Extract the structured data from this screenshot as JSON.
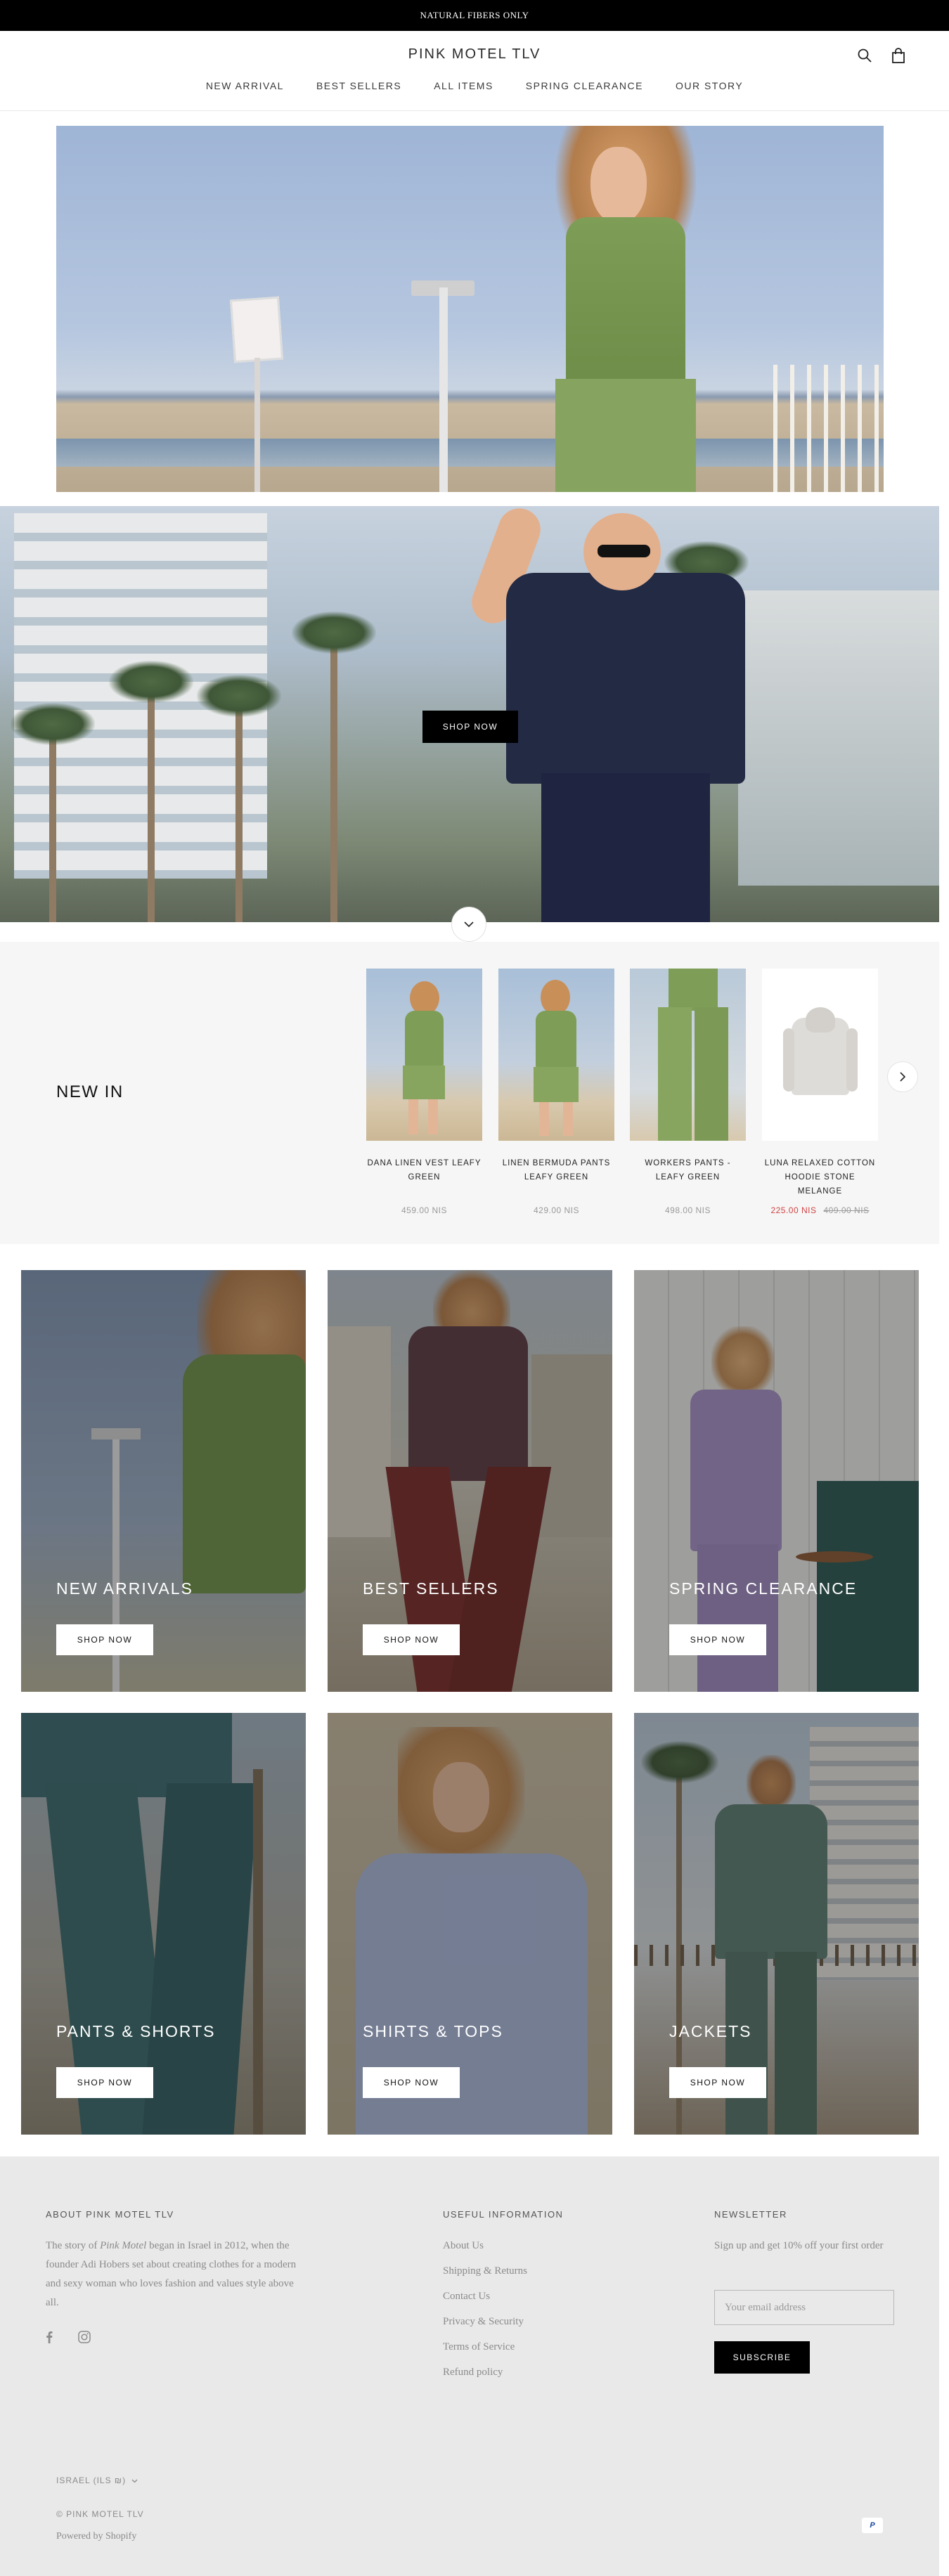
{
  "announcement": "NATURAL FIBERS ONLY",
  "header": {
    "logo": "PINK MOTEL TLV",
    "nav": [
      "NEW ARRIVAL",
      "BEST SELLERS",
      "ALL ITEMS",
      "SPRING CLEARANCE",
      "OUR STORY"
    ],
    "icons": [
      "search-icon",
      "bag-icon"
    ]
  },
  "hero": {
    "shop_now": "SHOP NOW"
  },
  "new_in": {
    "title": "NEW IN",
    "products": [
      {
        "name": "DANA LINEN VEST LEAFY GREEN",
        "price": "459.00 NIS"
      },
      {
        "name": "LINEN BERMUDA PANTS LEAFY GREEN",
        "price": "429.00 NIS"
      },
      {
        "name": "WORKERS PANTS - LEAFY GREEN",
        "price": "498.00 NIS"
      },
      {
        "name": "LUNA RELAXED COTTON HOODIE STONE MELANGE",
        "sale_price": "225.00 NIS",
        "compare_price": "409.00 NIS"
      }
    ]
  },
  "categories": [
    {
      "label": "NEW ARRIVALS",
      "button": "SHOP NOW"
    },
    {
      "label": "BEST SELLERS",
      "button": "SHOP NOW"
    },
    {
      "label": "SPRING CLEARANCE",
      "button": "SHOP NOW"
    },
    {
      "label": "PANTS & SHORTS",
      "button": "SHOP NOW"
    },
    {
      "label": "SHIRTS & TOPS",
      "button": "SHOP NOW"
    },
    {
      "label": "JACKETS",
      "button": "SHOP NOW"
    }
  ],
  "footer": {
    "about_title": "ABOUT PINK MOTEL TLV",
    "about_text_1": "The story of ",
    "about_brand": "Pink Motel",
    "about_text_2": " began in Israel in 2012, when the founder Adi Hobers set about creating clothes for a modern and sexy woman who loves fashion and values style above all.",
    "social": [
      "facebook-icon",
      "instagram-icon"
    ],
    "info_title": "USEFUL INFORMATION",
    "info_links": [
      "About Us",
      "Shipping & Returns",
      "Contact Us",
      "Privacy & Security",
      "Terms of Service",
      "Refund policy"
    ],
    "newsletter_title": "NEWSLETTER",
    "newsletter_text": "Sign up and get 10% off your first order",
    "email_placeholder": "Your email address",
    "subscribe": "SUBSCRIBE",
    "currency": "ISRAEL (ILS ₪)",
    "copyright": "© PINK MOTEL TLV",
    "powered": "Powered by Shopify",
    "payment": "PayPal"
  },
  "colors": {
    "black": "#000000",
    "footer_bg": "#e9e9ea",
    "sale": "#d14545",
    "newin_bg": "#f6f6f6"
  }
}
